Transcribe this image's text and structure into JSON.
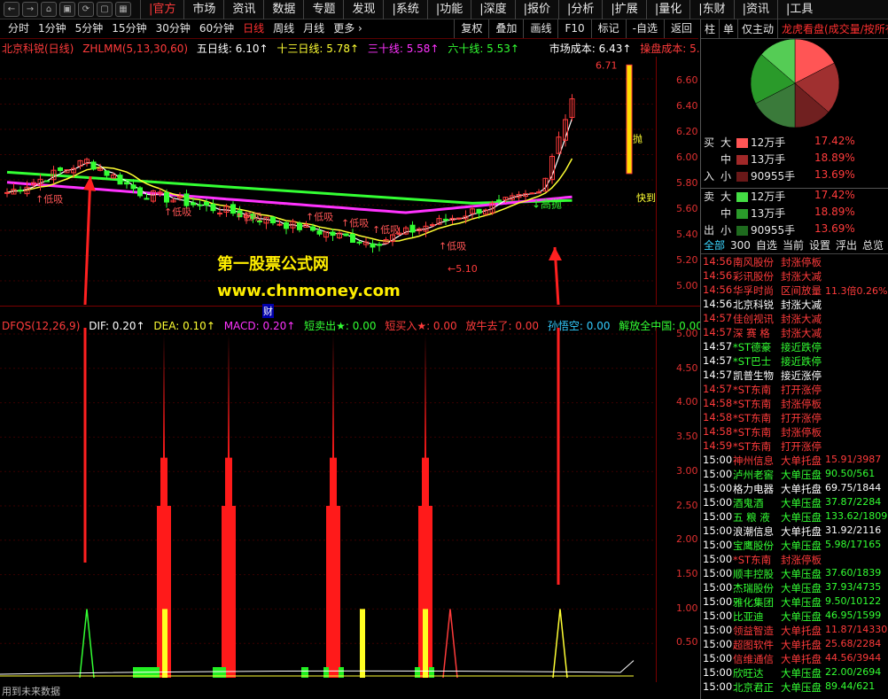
{
  "topnav": {
    "buttons": [
      "←",
      "→",
      "⌂",
      "▣",
      "⟳",
      "▢",
      "▦"
    ],
    "menu": [
      "|官方",
      "市场",
      "资讯",
      "数据",
      "专题",
      "发现",
      "|系统",
      "|功能",
      "|深度",
      "|报价",
      "|分析",
      "|扩展",
      "|量化",
      "|东财",
      "|资讯",
      "|工具"
    ]
  },
  "periodbar": {
    "periods": [
      "分时",
      "1分钟",
      "5分钟",
      "15分钟",
      "30分钟",
      "60分钟",
      "日线",
      "周线",
      "月线",
      "更多 ›"
    ],
    "active_period": "日线",
    "tools": [
      "复权",
      "叠加",
      "画线",
      "F10",
      "标记",
      "-自选",
      "返回"
    ]
  },
  "ma_legend": {
    "name": "北京科锐(日线)",
    "formula": "ZHLMM(5,13,30,60)",
    "ma5": "五日线: 6.10↑",
    "ma13": "十三日线: 5.78↑",
    "ma30": "三十线: 5.58↑",
    "ma60": "六十线: 5.53↑",
    "market_cost": "市场成本: 6.43↑",
    "trade_cost": "操盘成本: 5.",
    "colors": {
      "ma5": "#ffffff",
      "ma13": "#ffff33",
      "ma30": "#ff33ff",
      "ma60": "#33ff33",
      "red": "#ff3b3b"
    }
  },
  "kchart_labels": {
    "high_price": "6.71",
    "low_price": "5.10",
    "gaopao": "高抛",
    "dixi": "低吸",
    "kuai": "快到",
    "pao": "抛"
  },
  "kaxis": [
    "6.60",
    "6.40",
    "6.20",
    "6.00",
    "5.80",
    "5.60",
    "5.40",
    "5.20",
    "5.00"
  ],
  "watermark": {
    "cn": "第一股票公式网",
    "url": "www.chnmoney.com",
    "cai": "财"
  },
  "indicator": {
    "name": "DFQS(12,26,9)",
    "dif": "DIF: 0.20↑",
    "dea": "DEA: 0.10↑",
    "macd": "MACD: 0.20↑",
    "short_sell": "短卖出★: 0.00",
    "short_buy": "短买入★: 0.00",
    "bull_gone": "放牛去了: 0.00",
    "sun": "孙悟空: 0.00",
    "free": "解放全中国: 0.00"
  },
  "iaxis": [
    "5.00",
    "4.50",
    "4.00",
    "3.50",
    "3.00",
    "2.50",
    "2.00",
    "1.50",
    "1.00",
    "0.50"
  ],
  "footer": "用到未来数据",
  "rpanel": {
    "tabs": [
      "柱",
      "单",
      "仅主动",
      "龙虎看盘(成交量/按所有)"
    ],
    "pie_colors": [
      "#ff5555",
      "#a03030",
      "#702020",
      "#3a7a3a",
      "#2a9a2a",
      "#55cc55"
    ],
    "flows": [
      {
        "side": "买",
        "size": "大",
        "color": "#ff5555",
        "vol": "12万手",
        "pct": "17.42%"
      },
      {
        "side": "",
        "size": "中",
        "color": "#a02828",
        "vol": "13万手",
        "pct": "18.89%"
      },
      {
        "side": "入",
        "size": "小",
        "color": "#6a1818",
        "vol": "90955手",
        "pct": "13.69%"
      },
      {
        "side": "卖",
        "size": "大",
        "color": "#44dd44",
        "vol": "12万手",
        "pct": "17.42%"
      },
      {
        "side": "",
        "size": "中",
        "color": "#2a9a2a",
        "vol": "13万手",
        "pct": "18.89%"
      },
      {
        "side": "出",
        "size": "小",
        "color": "#1e6a1e",
        "vol": "90955手",
        "pct": "13.69%"
      }
    ],
    "alert_tabs": [
      "全部",
      "300",
      "自选",
      "当前",
      "设置",
      "浮出",
      "总览"
    ],
    "alerts": [
      {
        "time": "14:56",
        "name": "南风股份",
        "event": "封涨停板",
        "val": "",
        "c": "r"
      },
      {
        "time": "14:56",
        "name": "彩讯股份",
        "event": "封涨大减",
        "val": "",
        "c": "r"
      },
      {
        "time": "14:56",
        "name": "华孚时尚",
        "event": "区间放量",
        "val": "11.3倍0.26%",
        "c": "r"
      },
      {
        "time": "14:56",
        "name": "北京科锐",
        "event": "封涨大减",
        "val": "",
        "c": "w"
      },
      {
        "time": "14:57",
        "name": "佳创视讯",
        "event": "封涨大减",
        "val": "",
        "c": "r"
      },
      {
        "time": "14:57",
        "name": "深 赛 格",
        "event": "封涨大减",
        "val": "",
        "c": "r"
      },
      {
        "time": "14:57",
        "name": "*ST德豪",
        "event": "接近跌停",
        "val": "",
        "c": "g"
      },
      {
        "time": "14:57",
        "name": "*ST巴士",
        "event": "接近跌停",
        "val": "",
        "c": "g"
      },
      {
        "time": "14:57",
        "name": "凯普生物",
        "event": "接近涨停",
        "val": "",
        "c": "w"
      },
      {
        "time": "14:57",
        "name": "*ST东南",
        "event": "打开涨停",
        "val": "",
        "c": "r"
      },
      {
        "time": "14:58",
        "name": "*ST东南",
        "event": "封涨停板",
        "val": "",
        "c": "r"
      },
      {
        "time": "14:58",
        "name": "*ST东南",
        "event": "打开涨停",
        "val": "",
        "c": "r"
      },
      {
        "time": "14:58",
        "name": "*ST东南",
        "event": "封涨停板",
        "val": "",
        "c": "r"
      },
      {
        "time": "14:59",
        "name": "*ST东南",
        "event": "打开涨停",
        "val": "",
        "c": "r"
      },
      {
        "time": "15:00",
        "name": "神州信息",
        "event": "大单托盘",
        "val": "15.91/3987",
        "c": "r"
      },
      {
        "time": "15:00",
        "name": "泸州老窖",
        "event": "大单压盘",
        "val": "90.50/561",
        "c": "g"
      },
      {
        "time": "15:00",
        "name": "格力电器",
        "event": "大单托盘",
        "val": "69.75/1844",
        "c": "w"
      },
      {
        "time": "15:00",
        "name": "酒鬼酒",
        "event": "大单压盘",
        "val": "37.87/2284",
        "c": "g"
      },
      {
        "time": "15:00",
        "name": "五 粮 液",
        "event": "大单压盘",
        "val": "133.62/1809",
        "c": "g"
      },
      {
        "time": "15:00",
        "name": "浪潮信息",
        "event": "大单托盘",
        "val": "31.92/2116",
        "c": "w"
      },
      {
        "time": "15:00",
        "name": "宝鹰股份",
        "event": "大单压盘",
        "val": "5.98/17165",
        "c": "g"
      },
      {
        "time": "15:00",
        "name": "*ST东南",
        "event": "封涨停板",
        "val": "",
        "c": "r"
      },
      {
        "time": "15:00",
        "name": "顺丰控股",
        "event": "大单压盘",
        "val": "37.60/1839",
        "c": "g"
      },
      {
        "time": "15:00",
        "name": "杰瑞股份",
        "event": "大单压盘",
        "val": "37.93/4735",
        "c": "g"
      },
      {
        "time": "15:00",
        "name": "雅化集团",
        "event": "大单压盘",
        "val": "9.50/10122",
        "c": "g"
      },
      {
        "time": "15:00",
        "name": "比亚迪",
        "event": "大单压盘",
        "val": "46.95/1599",
        "c": "g"
      },
      {
        "time": "15:00",
        "name": "领益智造",
        "event": "大单托盘",
        "val": "11.87/14330",
        "c": "r"
      },
      {
        "time": "15:00",
        "name": "超图软件",
        "event": "大单托盘",
        "val": "25.68/2284",
        "c": "r"
      },
      {
        "time": "15:00",
        "name": "信维通信",
        "event": "大单托盘",
        "val": "44.56/3944",
        "c": "r"
      },
      {
        "time": "15:00",
        "name": "欣旺达",
        "event": "大单压盘",
        "val": "22.00/2694",
        "c": "g"
      },
      {
        "time": "15:00",
        "name": "北京君正",
        "event": "大单压盘",
        "val": "89.44/621",
        "c": "g"
      }
    ]
  }
}
